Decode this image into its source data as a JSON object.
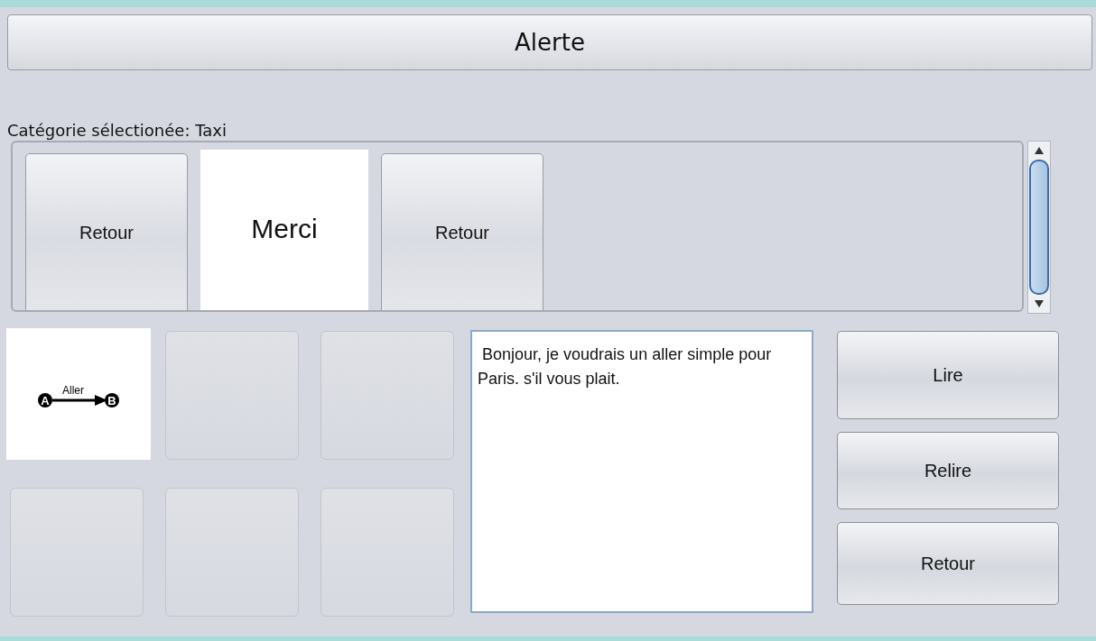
{
  "header": {
    "title": "Alerte"
  },
  "category_label": "Catégorie sélectionée: Taxi",
  "category_tiles": [
    {
      "kind": "button",
      "label": "Retour"
    },
    {
      "kind": "word",
      "label": "Merci"
    },
    {
      "kind": "button",
      "label": "Retour"
    }
  ],
  "pictogram_grid": [
    {
      "kind": "pictogram",
      "caption": "Aller",
      "from": "A",
      "to": "B"
    },
    {
      "kind": "empty"
    },
    {
      "kind": "empty"
    },
    {
      "kind": "empty"
    },
    {
      "kind": "empty"
    },
    {
      "kind": "empty"
    }
  ],
  "message": {
    "value": " Bonjour, je voudrais un aller simple pour Paris. s'il vous plait."
  },
  "buttons": [
    "Lire",
    "Relire",
    "Retour"
  ]
}
